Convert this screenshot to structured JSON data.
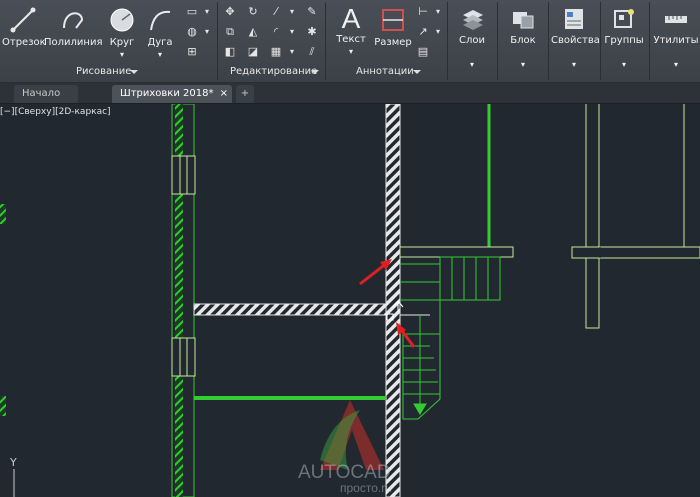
{
  "ribbon": {
    "draw": {
      "line": "Отрезок",
      "polyline": "Полилиния",
      "circle": "Круг",
      "arc": "Дуга",
      "panel": "Рисование"
    },
    "modify": {
      "panel": "Редактирование"
    },
    "annotation": {
      "text": "Текст",
      "dimension": "Размер",
      "panel": "Аннотации"
    },
    "layers": "Слои",
    "block": "Блок",
    "properties": "Свойства",
    "groups": "Группы",
    "utilities": "Утилиты"
  },
  "tabs": {
    "start": "Начало",
    "active": "Штриховки 2018*",
    "close": "×",
    "add": "+"
  },
  "viewport": {
    "label": "[−][Сверху][2D-каркас]",
    "ucs_y": "Y"
  },
  "watermark": {
    "title": "AUTOCAD",
    "subtitle": "просто.ru"
  },
  "colors": {
    "background": "#212830",
    "green": "#33cc33",
    "yellow_green": "#c8e89a",
    "hatch": "#e8e8e8",
    "arrow": "#e02020"
  }
}
